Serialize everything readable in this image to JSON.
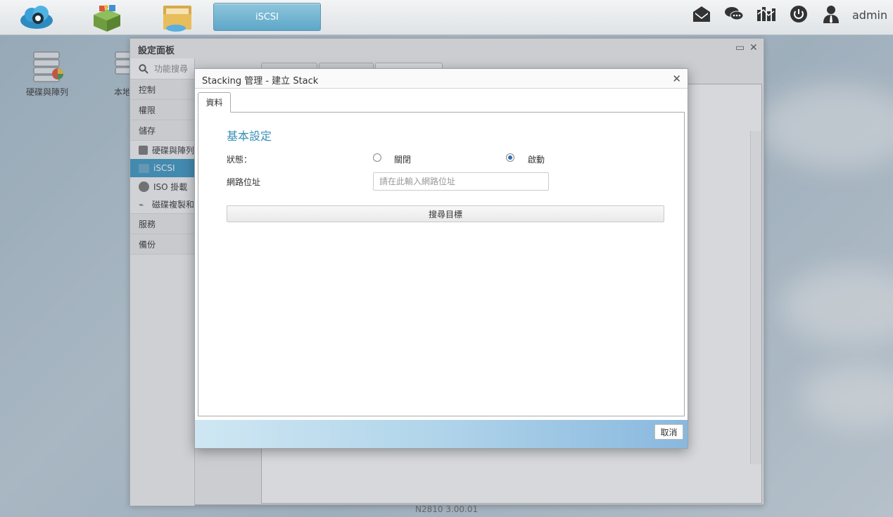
{
  "taskbar": {
    "active_task": "iSCSI",
    "user": "admin",
    "apps": [
      "cloud-app-icon",
      "app-center-icon",
      "file-manager-icon"
    ],
    "right_icons": [
      "mail-icon",
      "chat-icon",
      "monitor-icon",
      "power-icon",
      "user-icon"
    ]
  },
  "desktop": {
    "icons": [
      {
        "label": "硬碟與陣列",
        "icon": "disk-array-icon"
      },
      {
        "label": "本地",
        "icon": "local-storage-icon"
      }
    ]
  },
  "panel": {
    "title": "設定面板",
    "search_placeholder": "功能搜尋",
    "sidebar": [
      {
        "label": "控制"
      },
      {
        "label": "權限"
      },
      {
        "label": "儲存"
      }
    ],
    "storage_items": [
      {
        "label": "硬碟與陣列",
        "icon": "disk-icon"
      },
      {
        "label": "iSCSI",
        "icon": "iscsi-icon",
        "active": true
      },
      {
        "label": "ISO 掛載",
        "icon": "iso-icon"
      },
      {
        "label": "磁碟複製和",
        "icon": "clone-icon"
      }
    ],
    "sidebar_bottom": [
      {
        "label": "服務"
      },
      {
        "label": "備份"
      }
    ],
    "version": "N2810   3.00.01"
  },
  "modal": {
    "title": "Stacking 管理 - 建立 Stack",
    "tab": "資料",
    "section_title": "基本設定",
    "status_label": "狀態：",
    "status_off": "關閉",
    "status_on": "啟動",
    "status_value": "啟動",
    "ip_label": "網路位址",
    "ip_placeholder": "請在此輸入網路位址",
    "ip_value": "",
    "search_button": "搜尋目標",
    "cancel_button": "取消"
  }
}
